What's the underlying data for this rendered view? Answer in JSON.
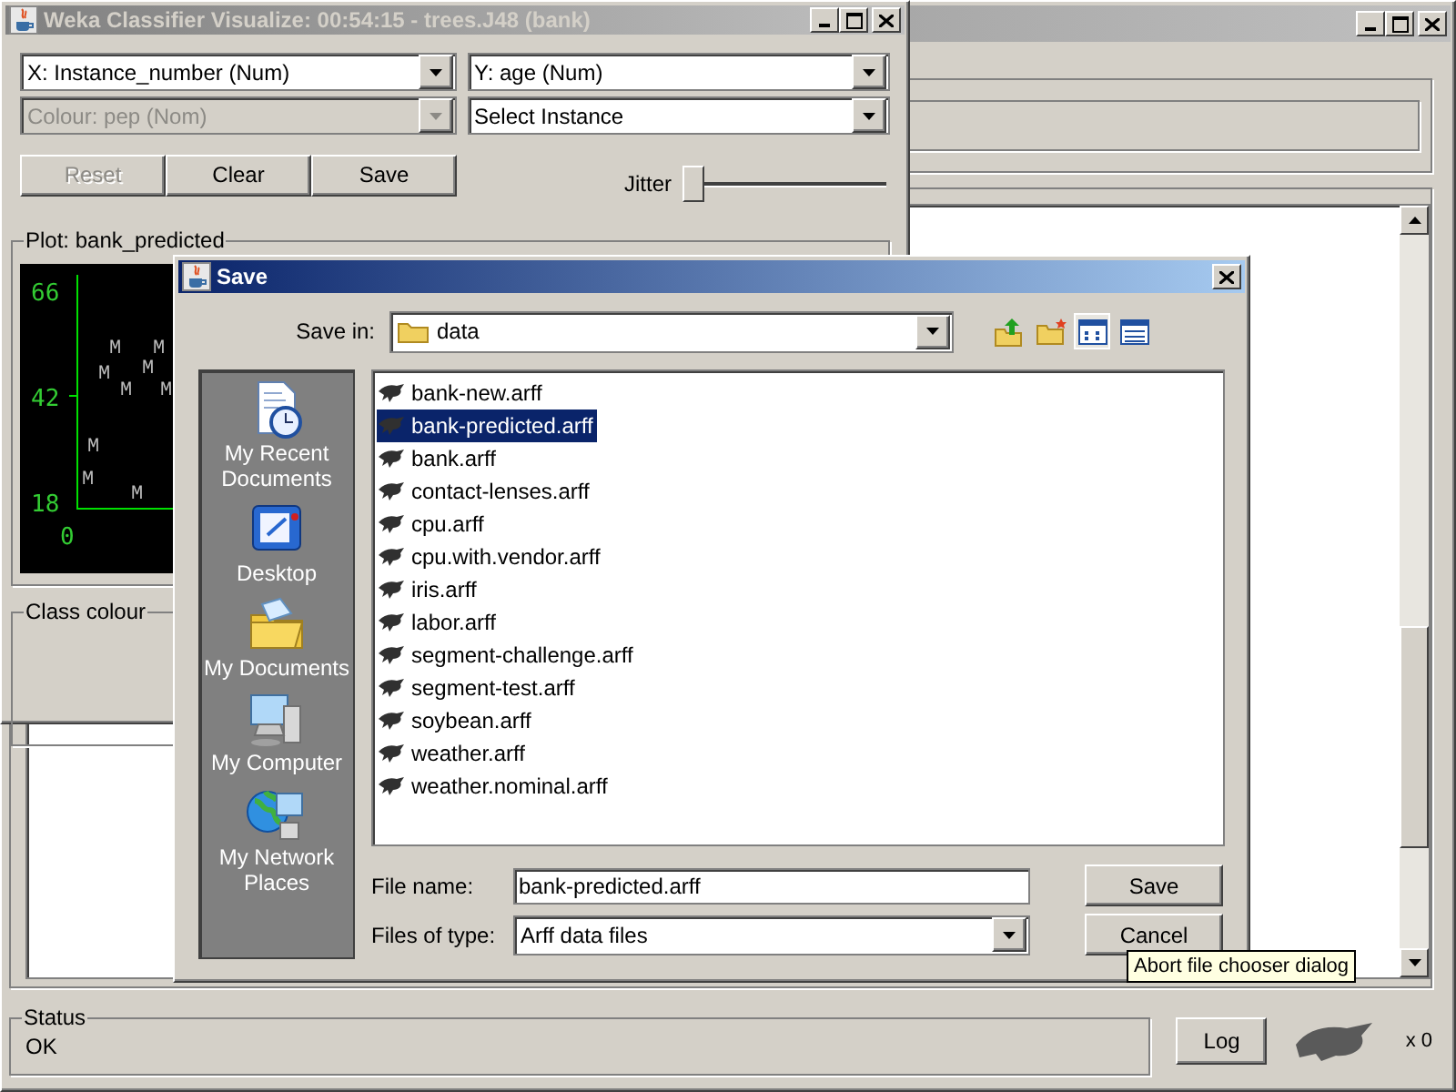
{
  "main_window": {
    "status": {
      "label": "Status",
      "text": "OK"
    },
    "log_button": "Log",
    "task_count": "x 0"
  },
  "visualize_window": {
    "title": "Weka Classifier Visualize: 00:54:15 - trees.J48 (bank)",
    "x_axis": "X: Instance_number (Num)",
    "y_axis": "Y: age (Num)",
    "colour": {
      "value": "Colour: pep (Nom)",
      "disabled": true
    },
    "instance_select": "Select Instance",
    "buttons": [
      {
        "label": "Reset",
        "disabled": true
      },
      {
        "label": "Clear",
        "disabled": false
      },
      {
        "label": "Save",
        "disabled": false
      }
    ],
    "jitter": {
      "label": "Jitter",
      "level": 0
    },
    "plot": {
      "title": "Plot: bank_predicted",
      "y_ticks": [
        "66",
        "42",
        "18"
      ],
      "origin": "0",
      "points": [
        {
          "label": "M"
        },
        {
          "label": "M"
        },
        {
          "label": "M"
        },
        {
          "label": "M"
        },
        {
          "label": "M"
        },
        {
          "label": "M"
        },
        {
          "label": "M"
        },
        {
          "label": "M"
        },
        {
          "label": "M"
        }
      ]
    },
    "class_colour": {
      "title": "Class colour"
    }
  },
  "save_dialog": {
    "title": "Save",
    "save_in_label": "Save in:",
    "save_in": "data",
    "places": [
      {
        "label": "My Recent Documents",
        "kind": "recent"
      },
      {
        "label": "Desktop",
        "kind": "desktop"
      },
      {
        "label": "My Documents",
        "kind": "documents"
      },
      {
        "label": "My Computer",
        "kind": "computer"
      },
      {
        "label": "My Network Places",
        "kind": "network"
      }
    ],
    "files": [
      {
        "name": "bank-new.arff",
        "selected": false
      },
      {
        "name": "bank-predicted.arff",
        "selected": true
      },
      {
        "name": "bank.arff",
        "selected": false
      },
      {
        "name": "contact-lenses.arff",
        "selected": false
      },
      {
        "name": "cpu.arff",
        "selected": false
      },
      {
        "name": "cpu.with.vendor.arff",
        "selected": false
      },
      {
        "name": "iris.arff",
        "selected": false
      },
      {
        "name": "labor.arff",
        "selected": false
      },
      {
        "name": "segment-challenge.arff",
        "selected": false
      },
      {
        "name": "segment-test.arff",
        "selected": false
      },
      {
        "name": "soybean.arff",
        "selected": false
      },
      {
        "name": "weather.arff",
        "selected": false
      },
      {
        "name": "weather.nominal.arff",
        "selected": false
      }
    ],
    "file_name_label": "File name:",
    "file_name": "bank-predicted.arff",
    "file_type_label": "Files of type:",
    "file_type": "Arff data files",
    "buttons": [
      "Save",
      "Cancel"
    ]
  },
  "tooltip": "Abort file chooser dialog"
}
